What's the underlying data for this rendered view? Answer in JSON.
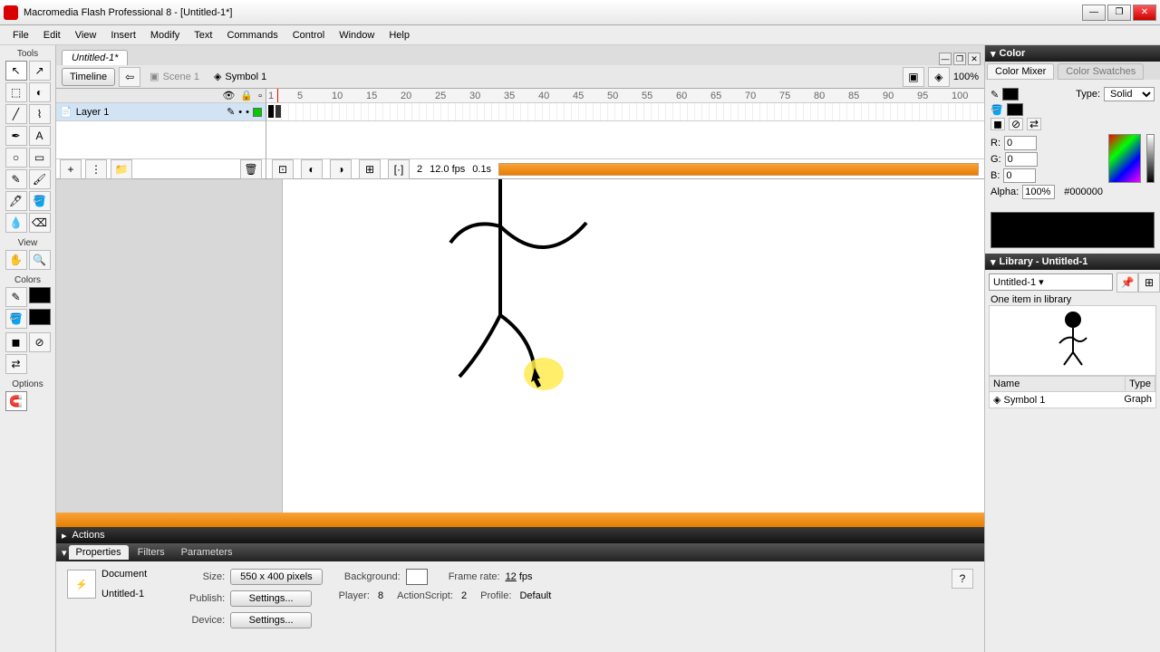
{
  "app": {
    "title": "Macromedia Flash Professional 8 - [Untitled-1*]"
  },
  "menu": [
    "File",
    "Edit",
    "View",
    "Insert",
    "Modify",
    "Text",
    "Commands",
    "Control",
    "Window",
    "Help"
  ],
  "tools_hdr": {
    "tools": "Tools",
    "view": "View",
    "colors": "Colors",
    "options": "Options"
  },
  "doc_tab": "Untitled-1*",
  "timeline_btn": "Timeline",
  "scene": "Scene 1",
  "symbol_crumb": "Symbol 1",
  "zoom": "100%",
  "layer": {
    "name": "Layer 1"
  },
  "ruler_marks": [
    "1",
    "5",
    "10",
    "15",
    "20",
    "25",
    "30",
    "35",
    "40",
    "45",
    "50",
    "55",
    "60",
    "65",
    "70",
    "75",
    "80",
    "85",
    "90",
    "95",
    "100"
  ],
  "frame_info": {
    "current": "2",
    "fps": "12.0 fps",
    "time": "0.1s"
  },
  "actions_label": "Actions",
  "prop_tabs": {
    "properties": "Properties",
    "filters": "Filters",
    "parameters": "Parameters"
  },
  "props": {
    "doc": "Document",
    "doc_name": "Untitled-1",
    "size_lbl": "Size:",
    "size_val": "550 x 400 pixels",
    "publish_lbl": "Publish:",
    "device_lbl": "Device:",
    "settings": "Settings...",
    "bg_lbl": "Background:",
    "frate_lbl": "Frame rate:",
    "frate_val": "12",
    "fps": "fps",
    "player_lbl": "Player:",
    "player_val": "8",
    "as_lbl": "ActionScript:",
    "as_val": "2",
    "profile_lbl": "Profile:",
    "profile_val": "Default"
  },
  "color_panel": {
    "hdr": "Color",
    "tab_mixer": "Color Mixer",
    "tab_swatch": "Color Swatches",
    "type_lbl": "Type:",
    "type_val": "Solid",
    "r_lbl": "R:",
    "r": "0",
    "g_lbl": "G:",
    "g": "0",
    "b_lbl": "B:",
    "b": "0",
    "alpha_lbl": "Alpha:",
    "alpha": "100%",
    "hex": "#000000"
  },
  "library": {
    "hdr": "Library - Untitled-1",
    "name": "Untitled-1",
    "count": "One item in library",
    "col_name": "Name",
    "col_type": "Type",
    "item_name": "Symbol 1",
    "item_type": "Graph"
  }
}
